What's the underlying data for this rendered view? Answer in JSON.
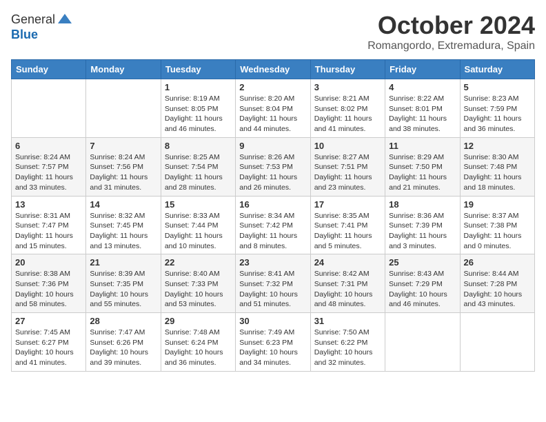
{
  "header": {
    "logo": {
      "general": "General",
      "blue": "Blue"
    },
    "title": "October 2024",
    "location": "Romangordo, Extremadura, Spain"
  },
  "weekdays": [
    "Sunday",
    "Monday",
    "Tuesday",
    "Wednesday",
    "Thursday",
    "Friday",
    "Saturday"
  ],
  "weeks": [
    [
      {
        "day": null,
        "info": ""
      },
      {
        "day": null,
        "info": ""
      },
      {
        "day": "1",
        "info": "Sunrise: 8:19 AM\nSunset: 8:05 PM\nDaylight: 11 hours and 46 minutes."
      },
      {
        "day": "2",
        "info": "Sunrise: 8:20 AM\nSunset: 8:04 PM\nDaylight: 11 hours and 44 minutes."
      },
      {
        "day": "3",
        "info": "Sunrise: 8:21 AM\nSunset: 8:02 PM\nDaylight: 11 hours and 41 minutes."
      },
      {
        "day": "4",
        "info": "Sunrise: 8:22 AM\nSunset: 8:01 PM\nDaylight: 11 hours and 38 minutes."
      },
      {
        "day": "5",
        "info": "Sunrise: 8:23 AM\nSunset: 7:59 PM\nDaylight: 11 hours and 36 minutes."
      }
    ],
    [
      {
        "day": "6",
        "info": "Sunrise: 8:24 AM\nSunset: 7:57 PM\nDaylight: 11 hours and 33 minutes."
      },
      {
        "day": "7",
        "info": "Sunrise: 8:24 AM\nSunset: 7:56 PM\nDaylight: 11 hours and 31 minutes."
      },
      {
        "day": "8",
        "info": "Sunrise: 8:25 AM\nSunset: 7:54 PM\nDaylight: 11 hours and 28 minutes."
      },
      {
        "day": "9",
        "info": "Sunrise: 8:26 AM\nSunset: 7:53 PM\nDaylight: 11 hours and 26 minutes."
      },
      {
        "day": "10",
        "info": "Sunrise: 8:27 AM\nSunset: 7:51 PM\nDaylight: 11 hours and 23 minutes."
      },
      {
        "day": "11",
        "info": "Sunrise: 8:29 AM\nSunset: 7:50 PM\nDaylight: 11 hours and 21 minutes."
      },
      {
        "day": "12",
        "info": "Sunrise: 8:30 AM\nSunset: 7:48 PM\nDaylight: 11 hours and 18 minutes."
      }
    ],
    [
      {
        "day": "13",
        "info": "Sunrise: 8:31 AM\nSunset: 7:47 PM\nDaylight: 11 hours and 15 minutes."
      },
      {
        "day": "14",
        "info": "Sunrise: 8:32 AM\nSunset: 7:45 PM\nDaylight: 11 hours and 13 minutes."
      },
      {
        "day": "15",
        "info": "Sunrise: 8:33 AM\nSunset: 7:44 PM\nDaylight: 11 hours and 10 minutes."
      },
      {
        "day": "16",
        "info": "Sunrise: 8:34 AM\nSunset: 7:42 PM\nDaylight: 11 hours and 8 minutes."
      },
      {
        "day": "17",
        "info": "Sunrise: 8:35 AM\nSunset: 7:41 PM\nDaylight: 11 hours and 5 minutes."
      },
      {
        "day": "18",
        "info": "Sunrise: 8:36 AM\nSunset: 7:39 PM\nDaylight: 11 hours and 3 minutes."
      },
      {
        "day": "19",
        "info": "Sunrise: 8:37 AM\nSunset: 7:38 PM\nDaylight: 11 hours and 0 minutes."
      }
    ],
    [
      {
        "day": "20",
        "info": "Sunrise: 8:38 AM\nSunset: 7:36 PM\nDaylight: 10 hours and 58 minutes."
      },
      {
        "day": "21",
        "info": "Sunrise: 8:39 AM\nSunset: 7:35 PM\nDaylight: 10 hours and 55 minutes."
      },
      {
        "day": "22",
        "info": "Sunrise: 8:40 AM\nSunset: 7:33 PM\nDaylight: 10 hours and 53 minutes."
      },
      {
        "day": "23",
        "info": "Sunrise: 8:41 AM\nSunset: 7:32 PM\nDaylight: 10 hours and 51 minutes."
      },
      {
        "day": "24",
        "info": "Sunrise: 8:42 AM\nSunset: 7:31 PM\nDaylight: 10 hours and 48 minutes."
      },
      {
        "day": "25",
        "info": "Sunrise: 8:43 AM\nSunset: 7:29 PM\nDaylight: 10 hours and 46 minutes."
      },
      {
        "day": "26",
        "info": "Sunrise: 8:44 AM\nSunset: 7:28 PM\nDaylight: 10 hours and 43 minutes."
      }
    ],
    [
      {
        "day": "27",
        "info": "Sunrise: 7:45 AM\nSunset: 6:27 PM\nDaylight: 10 hours and 41 minutes."
      },
      {
        "day": "28",
        "info": "Sunrise: 7:47 AM\nSunset: 6:26 PM\nDaylight: 10 hours and 39 minutes."
      },
      {
        "day": "29",
        "info": "Sunrise: 7:48 AM\nSunset: 6:24 PM\nDaylight: 10 hours and 36 minutes."
      },
      {
        "day": "30",
        "info": "Sunrise: 7:49 AM\nSunset: 6:23 PM\nDaylight: 10 hours and 34 minutes."
      },
      {
        "day": "31",
        "info": "Sunrise: 7:50 AM\nSunset: 6:22 PM\nDaylight: 10 hours and 32 minutes."
      },
      {
        "day": null,
        "info": ""
      },
      {
        "day": null,
        "info": ""
      }
    ]
  ]
}
